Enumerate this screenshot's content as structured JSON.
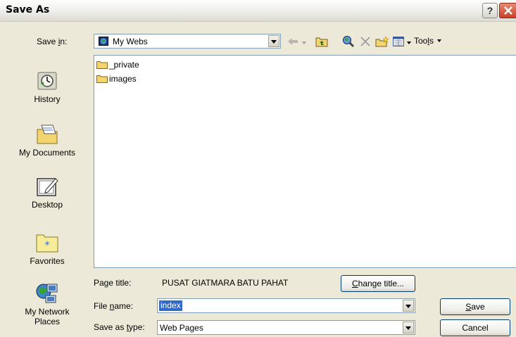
{
  "window": {
    "title": "Save As",
    "help_label": "?"
  },
  "savein": {
    "label_pre": "Save ",
    "label_key": "i",
    "label_post": "n:",
    "value": "My Webs"
  },
  "toolbar": {
    "tools_label_pre": "Too",
    "tools_label_key": "l",
    "tools_label_post": "s"
  },
  "places": [
    {
      "label": "History",
      "icon": "history-icon"
    },
    {
      "label": "My Documents",
      "icon": "my-documents-icon"
    },
    {
      "label": "Desktop",
      "icon": "desktop-icon"
    },
    {
      "label": "Favorites",
      "icon": "favorites-icon"
    },
    {
      "label_line1": "My Network",
      "label_line2": "Places",
      "icon": "network-places-icon"
    }
  ],
  "files": [
    {
      "name": "_private",
      "icon": "folder-icon"
    },
    {
      "name": "images",
      "icon": "folder-icon"
    }
  ],
  "page_title": {
    "label": "Page title:",
    "value": "PUSAT GIATMARA BATU PAHAT"
  },
  "change_title": {
    "pre": "",
    "key": "C",
    "post": "hange title..."
  },
  "file_name": {
    "label_pre": "File ",
    "label_key": "n",
    "label_post": "ame:",
    "value": "index"
  },
  "save_type": {
    "label_pre": "Save as ",
    "label_key": "t",
    "label_post": "ype:",
    "value": "Web Pages"
  },
  "save_button": {
    "key": "S",
    "post": "ave"
  },
  "cancel_button": {
    "label": "Cancel"
  },
  "colors": {
    "selection": "#316ac5",
    "face": "#ece9d8",
    "border": "#7f9db9"
  }
}
